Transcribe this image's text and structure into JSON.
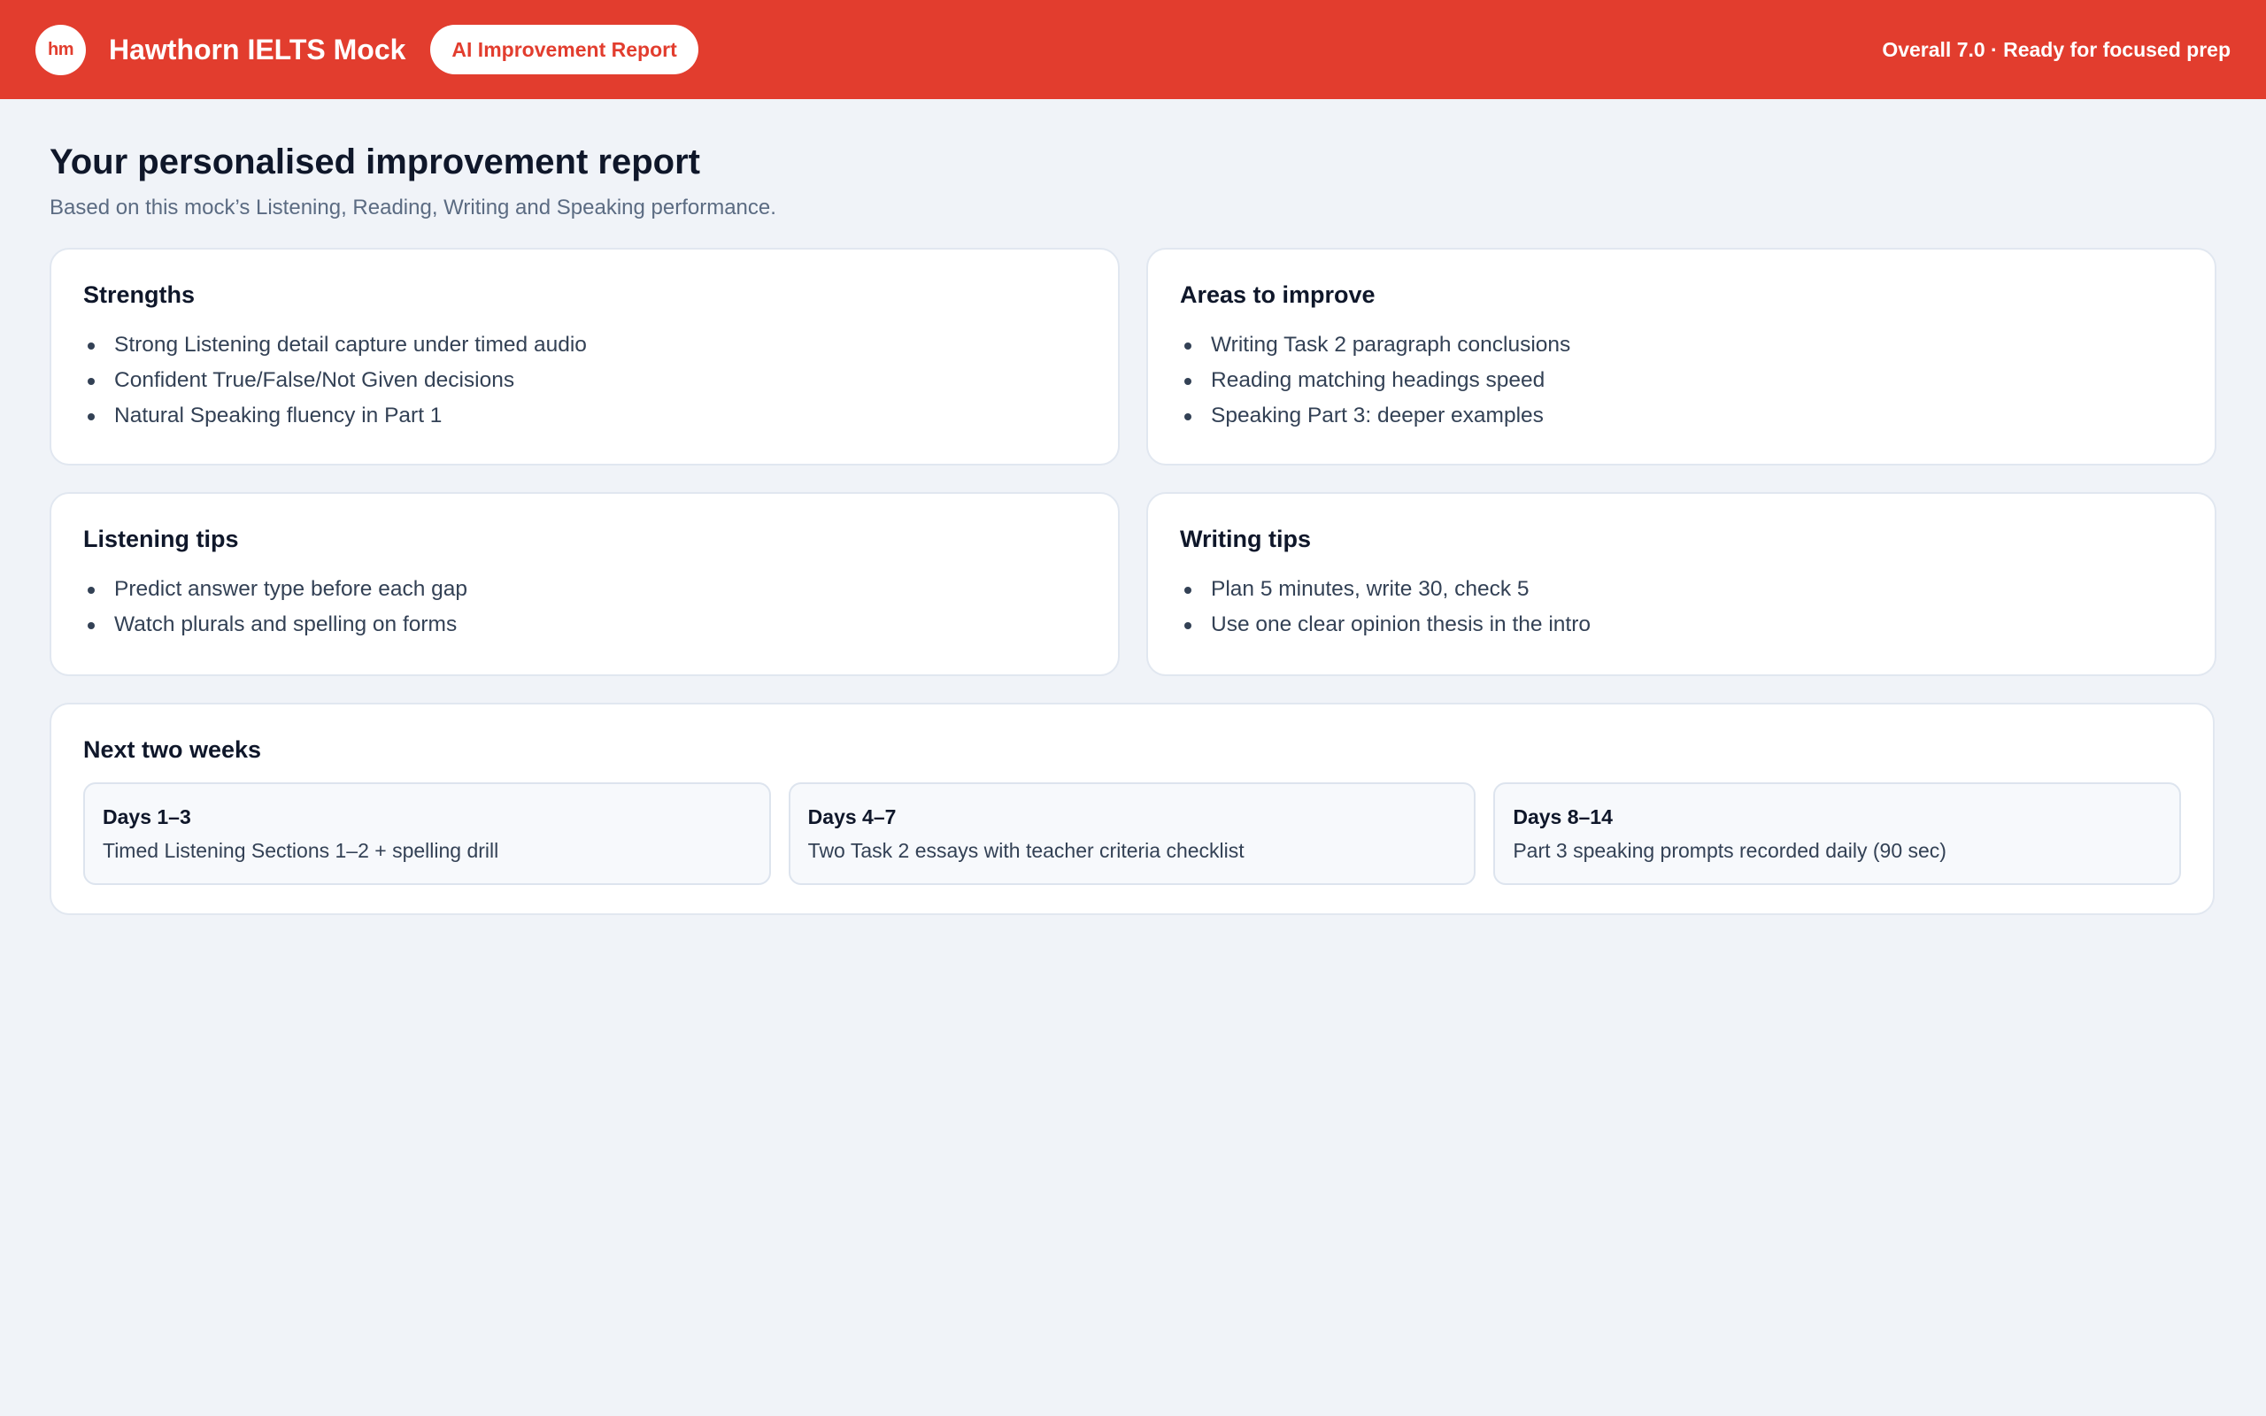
{
  "header": {
    "logo_text": "hm",
    "app_title": "Hawthorn IELTS Mock",
    "pill_label": "AI Improvement Report",
    "overall_status": "Overall 7.0 · Ready for focused prep",
    "accent_color": "#e23d2e"
  },
  "page": {
    "title": "Your personalised improvement report",
    "subtitle": "Based on this mock’s Listening, Reading, Writing and Speaking performance."
  },
  "strengths": {
    "title": "Strengths",
    "items": [
      "Strong Listening detail capture under timed audio",
      "Confident True/False/Not Given decisions",
      "Natural Speaking fluency in Part 1"
    ]
  },
  "areas": {
    "title": "Areas to improve",
    "items": [
      "Writing Task 2 paragraph conclusions",
      "Reading matching headings speed",
      "Speaking Part 3: deeper examples"
    ]
  },
  "listening_tips": {
    "title": "Listening tips",
    "items": [
      "Predict answer type before each gap",
      "Watch plurals and spelling on forms"
    ]
  },
  "writing_tips": {
    "title": "Writing tips",
    "items": [
      "Plan 5 minutes, write 30, check 5",
      "Use one clear opinion thesis in the intro"
    ]
  },
  "plan": {
    "title": "Next two weeks",
    "blocks": [
      {
        "days": "Days 1–3",
        "desc": "Timed Listening Sections 1–2 + spelling drill"
      },
      {
        "days": "Days 4–7",
        "desc": "Two Task 2 essays with teacher criteria checklist"
      },
      {
        "days": "Days 8–14",
        "desc": "Part 3 speaking prompts recorded daily (90 sec)"
      }
    ]
  }
}
